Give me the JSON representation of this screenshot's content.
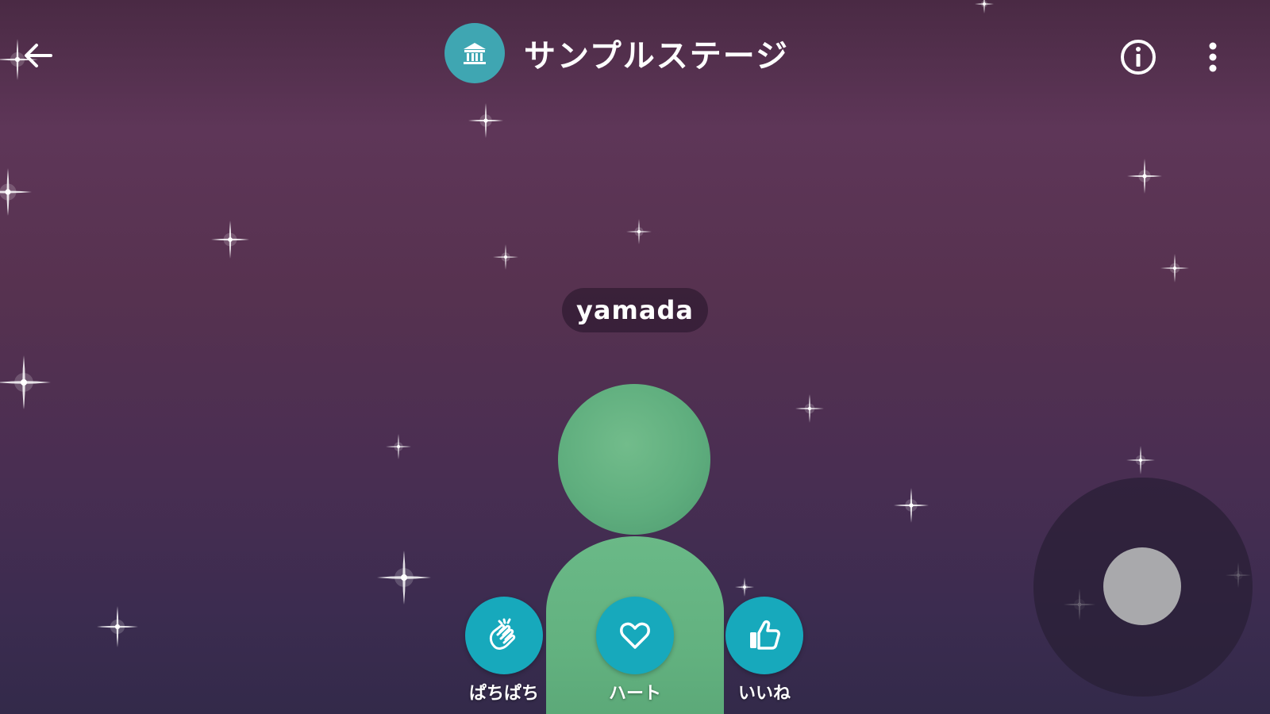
{
  "header": {
    "stage_title": "サンプルステージ",
    "venue_icon": "museum-icon",
    "back_icon": "arrow-left-icon",
    "info_icon": "info-icon",
    "more_icon": "more-vertical-icon"
  },
  "avatar": {
    "name": "yamada",
    "color": "#66b584"
  },
  "reactions": [
    {
      "label": "ぱちぱち",
      "icon": "clap-icon"
    },
    {
      "label": "ハート",
      "icon": "heart-icon"
    },
    {
      "label": "いいね",
      "icon": "thumbs-up-icon"
    }
  ],
  "colors": {
    "accent": "#17a9bc",
    "venue_badge": "#3fa6b2",
    "background_top": "#5e3658",
    "background_bottom": "#332a4a"
  }
}
